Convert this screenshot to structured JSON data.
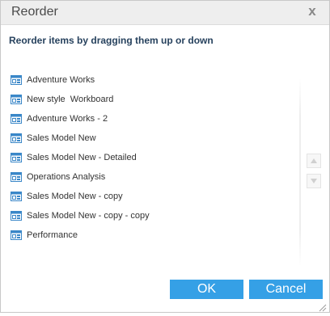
{
  "dialog": {
    "title": "Reorder",
    "close_glyph": "x",
    "close_icon": "close-icon",
    "instruction": "Reorder items by dragging them up or down",
    "item_icon": "dashboard-icon",
    "items": [
      {
        "label": "Adventure Works"
      },
      {
        "label": "New style  Workboard"
      },
      {
        "label": "Adventure Works - 2"
      },
      {
        "label": "Sales Model New"
      },
      {
        "label": "Sales Model New - Detailed"
      },
      {
        "label": "Operations Analysis"
      },
      {
        "label": "Sales Model New - copy"
      },
      {
        "label": "Sales Model New - copy - copy"
      },
      {
        "label": "Performance"
      }
    ],
    "move_up_icon": "triangle-up-icon",
    "move_down_icon": "triangle-down-icon",
    "ok_label": "OK",
    "cancel_label": "Cancel"
  },
  "colors": {
    "accent": "#35a0e6",
    "instruction_text": "#27425e",
    "icon_blue": "#3a87c8"
  }
}
